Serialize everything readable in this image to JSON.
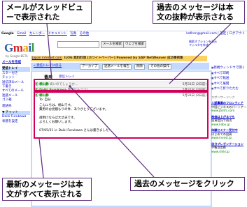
{
  "callouts": {
    "top_left": "メールがスレッドビューで表示された",
    "top_right": "過去のメッセージは本文の抜粋が表示される",
    "bottom_left": "最新のメッセージは本文がすべて表示される",
    "bottom_right": "過去のメッセージをクリック"
  },
  "topnav": [
    "Google",
    "Gmail",
    "カレンダー",
    "ドキュメント",
    "写真",
    "その他"
  ],
  "userbar": "kafiren@gmail.com | 設定 | ログアウト",
  "logo": {
    "letters": [
      "G",
      "m",
      "a",
      "i",
      "l"
    ],
    "beta": "by Google BETA"
  },
  "search": {
    "mail_button": "メールを検索",
    "web_button": "ウェブを検索"
  },
  "search_options": [
    "検索オプションを表示",
    "フィルタを作成"
  ],
  "ad_top": {
    "prefix": "Japan internet.com",
    "text": "ILOG 無料料理 [ホワイトペーパー] Powered by SAP NetWeaver 成功事例集"
  },
  "leftnav": {
    "compose": "メールを作成",
    "items": [
      "受信トレイ",
      "スター付き",
      "チャット",
      "送信済みメール",
      "下書き",
      "すべてのメール",
      "迷惑メール",
      "ゴミ箱"
    ],
    "contacts": "連絡先",
    "labels_heading": "▼ ラベル",
    "chat_heading": "▼ チャット",
    "chat_user": "Daiki Furukawa",
    "chat_status": "状態を設定"
  },
  "toolbar": {
    "back": "« 受信トレイに戻る",
    "archive": "アーカイブ",
    "spam": "迷惑メールを報告",
    "delete": "削除",
    "more": "その他の操作"
  },
  "conversation": {
    "subject": "費用",
    "label": "受信トレイ",
    "rows": [
      {
        "sender": "Ⓑ 桐山静",
        "snippet": "高いのでしょうか...",
        "date": "5月31日 (2日前)"
      },
      {
        "sender": "Ⓑ Daiki Furukawa",
        "snippet": "費用はもう少し...",
        "date": "5月31日 (2日前)"
      },
      {
        "sender": "Ⓑ 桐山静",
        "snippet": "",
        "date": "5月31日 (2日前)"
      }
    ],
    "to_line": "To: 自分",
    "body_lines": [
      "こんにちは、桐山です。",
      "費用のお見積もりの件、ありがとうございます。",
      "",
      "週明けならば大丈夫です。",
      "よろしくお願いします。"
    ],
    "quote_header": "07/05/31 に Daiki Furukawa さんは書きました:",
    "actions": [
      "返信",
      "転送",
      "桐山静: チャットの招待"
    ]
  },
  "rightcol": {
    "actions": [
      "新規ウィンドウで開く",
      "すべて印刷",
      "すべて転送",
      "すべて展開",
      "すべて折りたたむ"
    ],
    "sponsor_heading": "スポンサーリンク",
    "ads": [
      {
        "title": "人脈事業のフロンティア",
        "desc": "中国ビジネスのパートナー",
        "url": "www.jbmfc.com"
      },
      {
        "title": "株価は上がるでも",
        "desc": "投資信託で成功",
        "url": "www.kabu.jp"
      },
      {
        "title": "体験セミナー受付中",
        "desc": "はじめての投資",
        "url": "www.invest.jp"
      },
      {
        "title": "自分プレゼンテーション",
        "desc": "手帳活用術",
        "url": "www.shiki.jp"
      }
    ]
  }
}
